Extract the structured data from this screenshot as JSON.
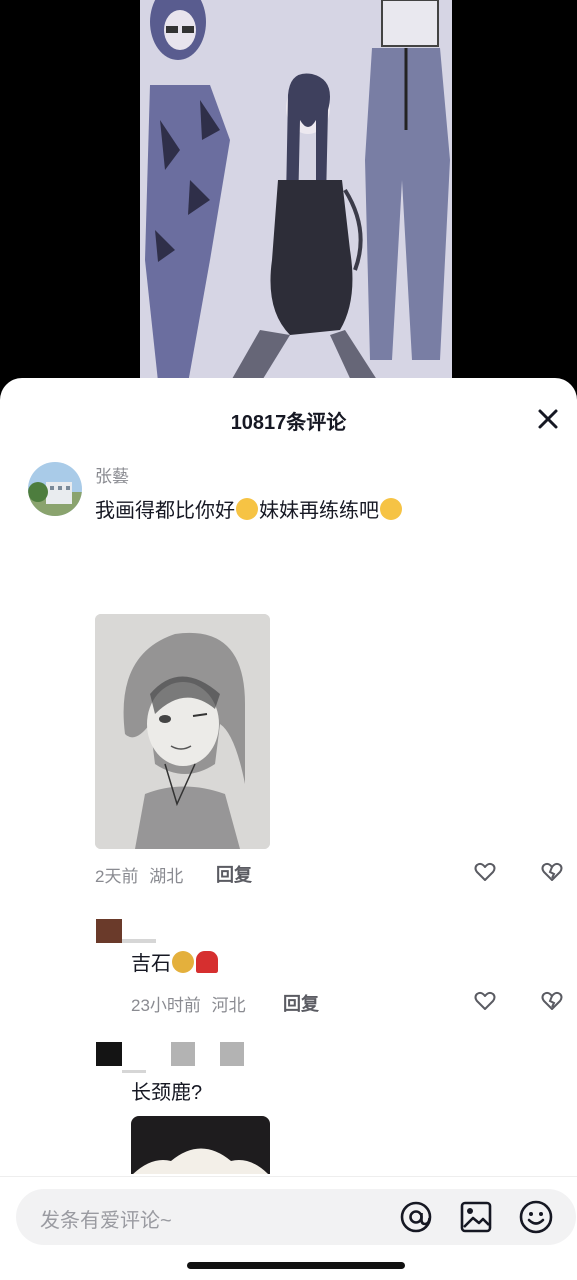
{
  "sheet": {
    "title": "10817条评论"
  },
  "comments": [
    {
      "username": "张藝",
      "text_a": "我画得都比你好",
      "emoji_a": "kissing-face-emoji",
      "text_b": "妹妹再练练吧",
      "emoji_b": "star-struck-emoji",
      "time": "2天前",
      "location": "湖北",
      "reply_label": "回复"
    },
    {
      "text_a": "吉石",
      "emoji_a": "helmet-face-emoji",
      "emoji_b": "rose-emoji",
      "time": "23小时前",
      "location": "河北",
      "reply_label": "回复"
    },
    {
      "text_a": "长颈鹿?"
    }
  ],
  "input": {
    "placeholder": "发条有爱评论~"
  },
  "colors": {
    "accent_text": "#161823",
    "muted_text": "#8a8b91",
    "sheet_bg": "#ffffff",
    "input_bg": "#f2f2f3"
  }
}
